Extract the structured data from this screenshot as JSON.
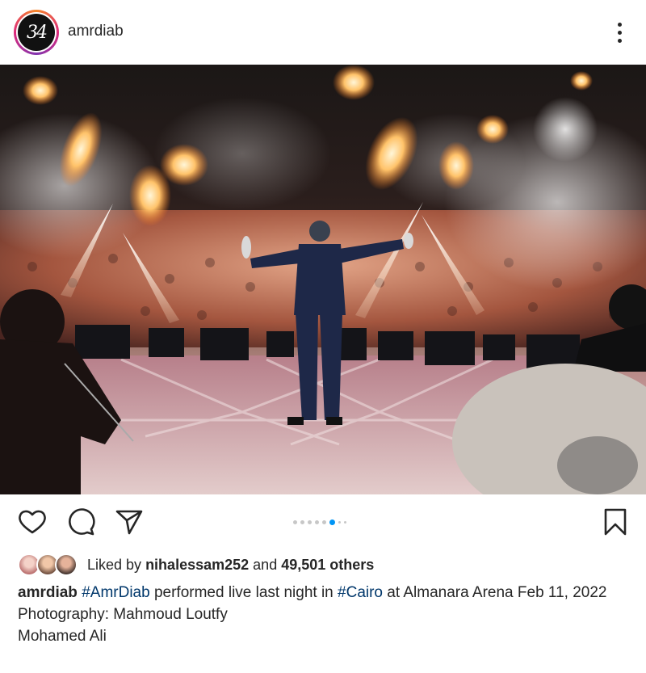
{
  "header": {
    "avatar_text": "34",
    "username": "amrdiab"
  },
  "colors": {
    "link": "#00376b",
    "active_dot": "#0095f6",
    "text": "#262626"
  },
  "carousel": {
    "total": 8,
    "active_index": 5
  },
  "likes": {
    "prefix": "Liked by",
    "user": "nihalessam252",
    "middle": "and",
    "others": "49,501 others"
  },
  "caption": {
    "author": "amrdiab",
    "hashtag1": "#AmrDiab",
    "text1": "performed live last night in",
    "hashtag2": "#Cairo",
    "text2": "at Almanara Arena Feb 11, 2022",
    "line2": "Photography: Mahmoud Loutfy",
    "line3": "Mohamed Ali"
  },
  "icons": [
    "heart-icon",
    "comment-icon",
    "share-icon",
    "bookmark-icon",
    "more-options-icon"
  ]
}
